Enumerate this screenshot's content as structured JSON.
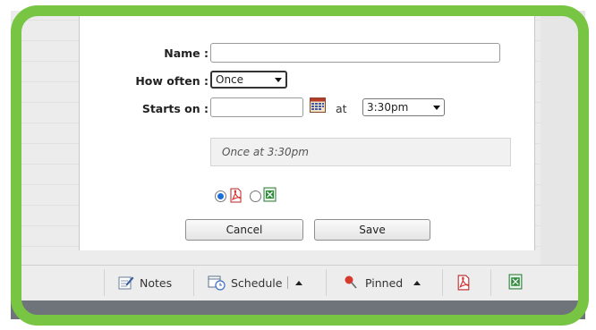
{
  "form": {
    "name_label": "Name :",
    "name_value": "",
    "how_often_label": "How often :",
    "how_often_value": "Once",
    "starts_on_label": "Starts on :",
    "starts_on_value": "",
    "at_label": "at",
    "time_value": "3:30pm",
    "summary_text": "Once at 3:30pm",
    "format_selected": "pdf"
  },
  "buttons": {
    "cancel": "Cancel",
    "save": "Save"
  },
  "toolbar": {
    "notes": "Notes",
    "schedule": "Schedule",
    "pinned": "Pinned"
  },
  "colors": {
    "frame": "#77c543",
    "radio_selected": "#1a6fd6",
    "pdf": "#d6302d",
    "excel": "#2e8b3a"
  }
}
